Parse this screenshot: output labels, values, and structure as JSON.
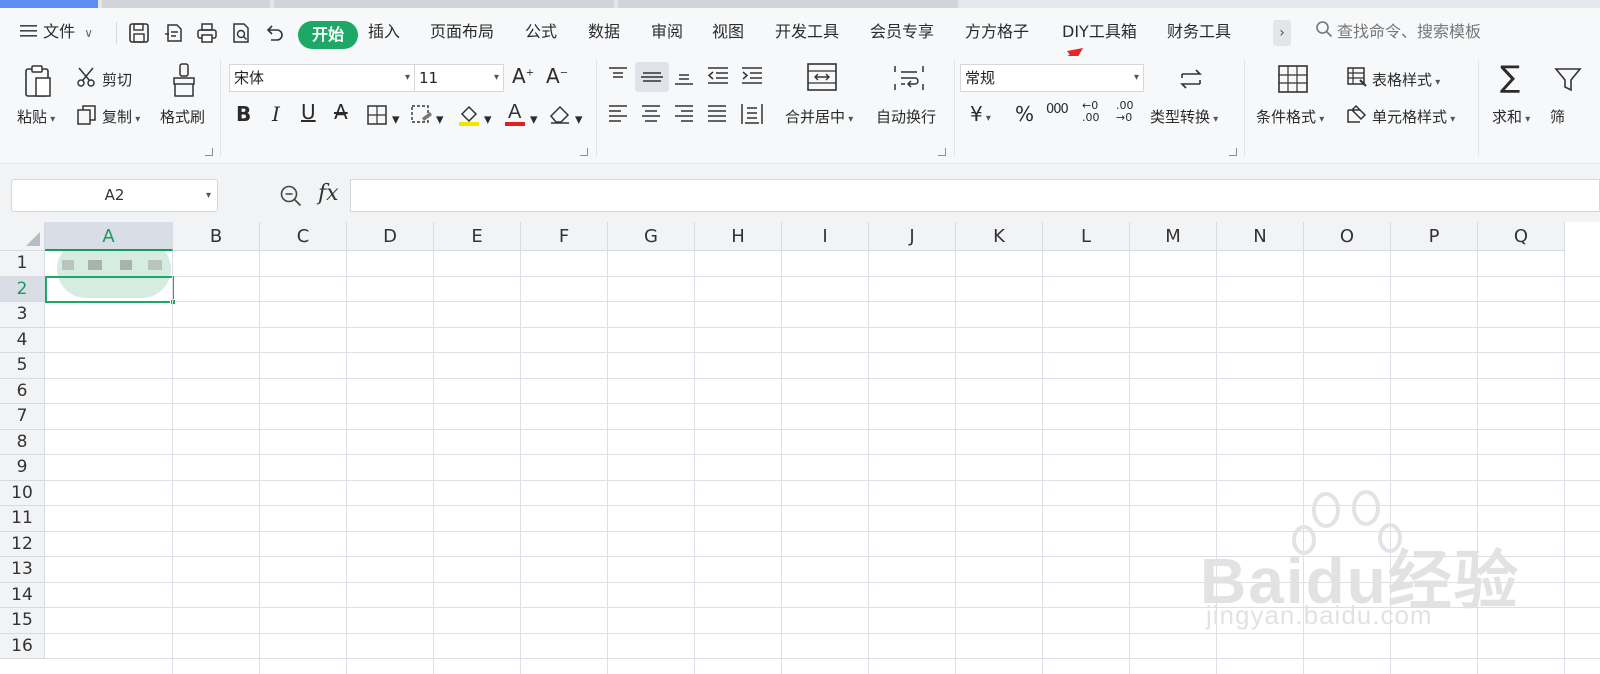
{
  "file_menu": {
    "label": "文件",
    "icon": "hamburger-icon"
  },
  "menu_tabs": [
    {
      "label": "开始",
      "active": true
    },
    {
      "label": "插入"
    },
    {
      "label": "页面布局"
    },
    {
      "label": "公式"
    },
    {
      "label": "数据"
    },
    {
      "label": "审阅"
    },
    {
      "label": "视图"
    },
    {
      "label": "开发工具"
    },
    {
      "label": "会员专享"
    },
    {
      "label": "方方格子"
    },
    {
      "label": "DIY工具箱"
    },
    {
      "label": "财务工具"
    }
  ],
  "more_tabs_glyph": "›",
  "search_commands": {
    "placeholder": "查找命令、搜索模板",
    "icon": "search-icon"
  },
  "ribbon": {
    "clipboard": {
      "paste": "粘贴",
      "cut": "剪切",
      "copy": "复制",
      "format_painter": "格式刷"
    },
    "font": {
      "font_name": "宋体",
      "font_size": "11"
    },
    "alignment": {
      "merge_center": "合并居中",
      "wrap_text": "自动换行"
    },
    "number": {
      "format": "常规",
      "currency_symbol": "¥",
      "percent_symbol": "%",
      "thousands_symbol": "000",
      "increase_decimal": "←0 .00",
      "decrease_decimal": ".00 →0",
      "type_convert": "类型转换"
    },
    "styles": {
      "conditional_format": "条件格式",
      "table_style": "表格样式",
      "cell_style": "单元格样式"
    },
    "editing": {
      "sum": "求和",
      "filter": "筛"
    }
  },
  "formula_bar": {
    "name_box": "A2",
    "fx_label": "fx",
    "formula": ""
  },
  "grid": {
    "columns": [
      "A",
      "B",
      "C",
      "D",
      "E",
      "F",
      "G",
      "H",
      "I",
      "J",
      "K",
      "L",
      "M",
      "N",
      "O",
      "P",
      "Q"
    ],
    "rows": [
      "1",
      "2",
      "3",
      "4",
      "5",
      "6",
      "7",
      "8",
      "9",
      "10",
      "11",
      "12",
      "13",
      "14",
      "15",
      "16"
    ],
    "selected_cell": "A2"
  },
  "watermark": {
    "brand": "Baidu经验",
    "url": "jingyan.baidu.com"
  },
  "colors": {
    "accent_green": "#1da867",
    "annotation_red": "#e8262a"
  }
}
